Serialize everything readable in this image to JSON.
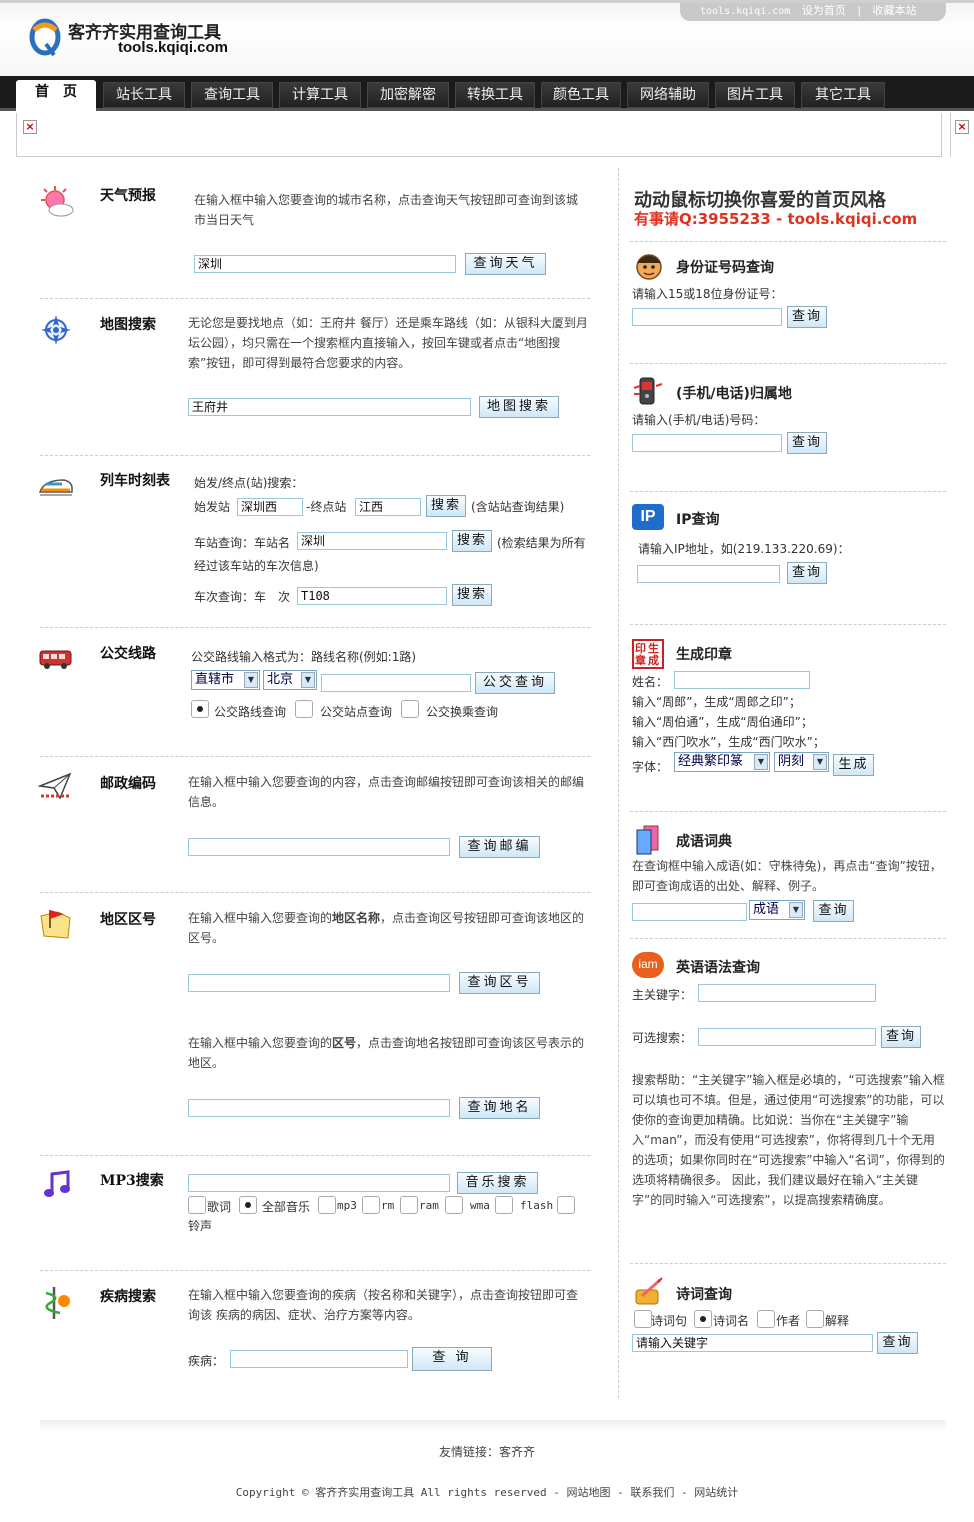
{
  "header": {
    "site_domain": "tools.kqiqi.com",
    "set_home": "设为首页",
    "separator": "|",
    "bookmark": "收藏本站",
    "logo_title": "客齐齐实用查询工具",
    "logo_domain": "tools.kqiqi.com"
  },
  "nav": {
    "items": [
      "首　页",
      "站长工具",
      "查询工具",
      "计算工具",
      "加密解密",
      "转换工具",
      "颜色工具",
      "网络辅助",
      "图片工具",
      "其它工具"
    ]
  },
  "weather": {
    "title": "天气预报",
    "desc": "在输入框中输入您要查询的城市名称，点击查询天气按钮即可查询到该城市当日天气",
    "value": "深圳",
    "button": "查询天气"
  },
  "map": {
    "title": "地图搜索",
    "desc": "无论您是要找地点（如：王府井 餐厅）还是乘车路线（如：从银科大厦到月坛公园），均只需在一个搜索框内直接输入，按回车键或者点击“地图搜索”按钮，即可得到最符合您要求的内容。",
    "value": "王府井",
    "button": "地图搜索"
  },
  "train": {
    "title": "列车时刻表",
    "line1": "始发/终点(站)搜索：",
    "start_label": "始发站",
    "start_value": "深圳西",
    "end_label": "-终点站",
    "end_value": "江西",
    "search_btn": "搜索",
    "hint1": "(含站站查询结果)",
    "station_label": "车站查询：车站名",
    "station_value": "深圳",
    "hint2a": "(检索结果为所有",
    "hint2b": "经过该车站的车次信息)",
    "number_label": "车次查询：车　次",
    "number_value": "T108"
  },
  "bus": {
    "title": "公交线路",
    "hint": "公交路线输入格式为：路线名称(例如:1路)",
    "region": "直辖市",
    "city": "北京",
    "button": "公交查询",
    "options": [
      "公交路线查询",
      "公交站点查询",
      "公交换乘查询"
    ]
  },
  "postcode": {
    "title": "邮政编码",
    "desc": "在输入框中输入您要查询的内容，点击查询邮编按钮即可查询该相关的邮编信息。",
    "button": "查询邮编"
  },
  "areacode": {
    "title": "地区区号",
    "desc1a": "在输入框中输入您要查询的",
    "desc1b": "地区名称",
    "desc1c": "，点击查询区号按钮即可查询该地区的区号。",
    "button1": "查询区号",
    "desc2a": "在输入框中输入您要查询的",
    "desc2b": "区号",
    "desc2c": "，点击查询地名按钮即可查询该区号表示的地区。",
    "button2": "查询地名"
  },
  "mp3": {
    "title": "MP3搜索",
    "button": "音乐搜索",
    "options": [
      "歌词",
      "全部音乐",
      "mp3",
      "rm",
      "ram",
      "wma",
      "flash",
      "铃声"
    ]
  },
  "disease": {
    "title": "疾病搜索",
    "desc": "在输入框中输入您要查询的疾病（按名称和关键字），点击查询按钮即可查询该 疾病的病因、症状、治疗方案等内容。",
    "label": "疾病：",
    "button": "查 询"
  },
  "banner": {
    "line1": "动动鼠标切换你喜爱的首页风格",
    "line2": "有事请Q:3955233 - tools.kqiqi.com"
  },
  "idcard": {
    "title": "身份证号码查询",
    "hint": "请输入15或18位身份证号：",
    "button": "查询"
  },
  "phone": {
    "title": "(手机/电话)归属地",
    "hint": "请输入(手机/电话)号码：",
    "button": "查询"
  },
  "ip": {
    "badge": "IP",
    "title": "IP查询",
    "hint": "请输入IP地址，如(219.133.220.69)：",
    "button": "查询"
  },
  "seal": {
    "badge": "印生章成",
    "title": "生成印章",
    "name_label": "姓名：",
    "ex1": "输入“周郎”，生成“周郎之印”；",
    "ex2": "输入“周伯通”，生成“周伯通印”；",
    "ex3": "输入“西门吹水”，生成“西门吹水”；",
    "font_label": "字体：",
    "font_value": "经典繁印篆",
    "style_value": "阴刻",
    "button": "生成"
  },
  "idiom": {
    "title": "成语词典",
    "desc": "在查询框中输入成语(如：守株待兔)，再点击“查询”按钮，即可查询成语的出处、解释、例子。",
    "select": "成语",
    "button": "查询"
  },
  "english": {
    "badge": "iam",
    "title": "英语语法查询",
    "key_label": "主关键字：",
    "opt_label": "可选搜索：",
    "button": "查询",
    "help": "搜索帮助：“主关键字”输入框是必填的，“可选搜索”输入框可以填也可不填。但是，通过使用“可选搜索”的功能，可以使你的查询更加精确。比如说：当你在“主关键字”输入“man”，而没有使用“可选搜索”，你将得到几十个无用的选项；如果你同时在“可选搜索”中输入“名词”，你得到的选项将精确很多。 因此，我们建议最好在输入“主关键字”的同时输入“可选搜索”，以提高搜索精确度。"
  },
  "poetry": {
    "title": "诗词查询",
    "options": [
      "诗词句",
      "诗词名",
      "作者",
      "解释"
    ],
    "value": "请输入关键字",
    "button": "查询"
  },
  "footer": {
    "links_label": "友情链接：",
    "friend": "客齐齐",
    "copyright": "Copyright © 客齐齐实用查询工具 All rights reserved - ",
    "sitemap": "网站地图",
    "dash": " - ",
    "contact": "联系我们",
    "stats": "网站统计"
  },
  "colors": {
    "accent_red": "#d32222",
    "nav_bg": "#1b1b1b",
    "input_border": "#9cc6dc"
  }
}
